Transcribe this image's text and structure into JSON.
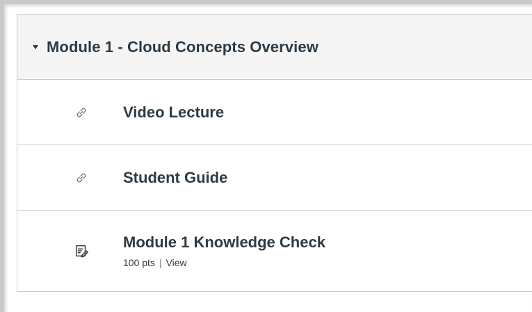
{
  "module": {
    "title": "Module 1 - Cloud Concepts Overview",
    "items": [
      {
        "title": "Video Lecture",
        "icon": "link-icon"
      },
      {
        "title": "Student Guide",
        "icon": "link-icon"
      },
      {
        "title": "Module 1 Knowledge Check",
        "icon": "quiz-icon",
        "points": "100 pts",
        "separator": "|",
        "action": "View"
      }
    ]
  },
  "colors": {
    "text": "#2d3b45",
    "header_bg": "#f5f5f5",
    "border": "#c7cdd1"
  }
}
